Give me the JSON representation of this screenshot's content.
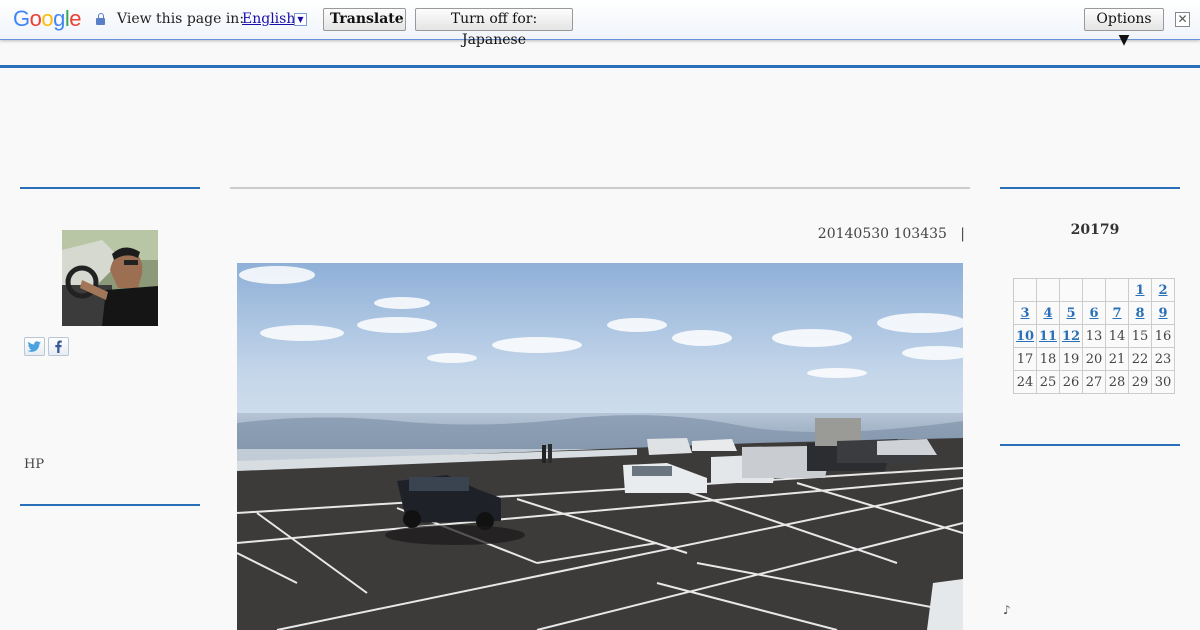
{
  "translate_bar": {
    "logo": "Google",
    "view_label": "View this page in:",
    "language": "English",
    "translate_button": "Translate",
    "turn_off_button": "Turn off for: Japanese",
    "options_button": "Options ▼",
    "close_glyph": "✕",
    "lang_arrow": "▼"
  },
  "left_sidebar": {
    "hp_link": "HP"
  },
  "post": {
    "meta": "20140530 103435   |"
  },
  "calendar": {
    "title": "20179",
    "weeks": [
      [
        "",
        "",
        "",
        "",
        "",
        "1",
        "2"
      ],
      [
        "3",
        "4",
        "5",
        "6",
        "7",
        "8",
        "9"
      ],
      [
        "10",
        "11",
        "12",
        "13",
        "14",
        "15",
        "16"
      ],
      [
        "17",
        "18",
        "19",
        "20",
        "21",
        "22",
        "23"
      ],
      [
        "24",
        "25",
        "26",
        "27",
        "28",
        "29",
        "30"
      ]
    ],
    "linked_days": [
      "1",
      "2",
      "3",
      "4",
      "5",
      "6",
      "7",
      "8",
      "9",
      "10",
      "11",
      "12"
    ]
  },
  "music_note": "♪",
  "colors": {
    "accent_blue": "#2a70b8",
    "link_blue": "#1a0dab"
  }
}
